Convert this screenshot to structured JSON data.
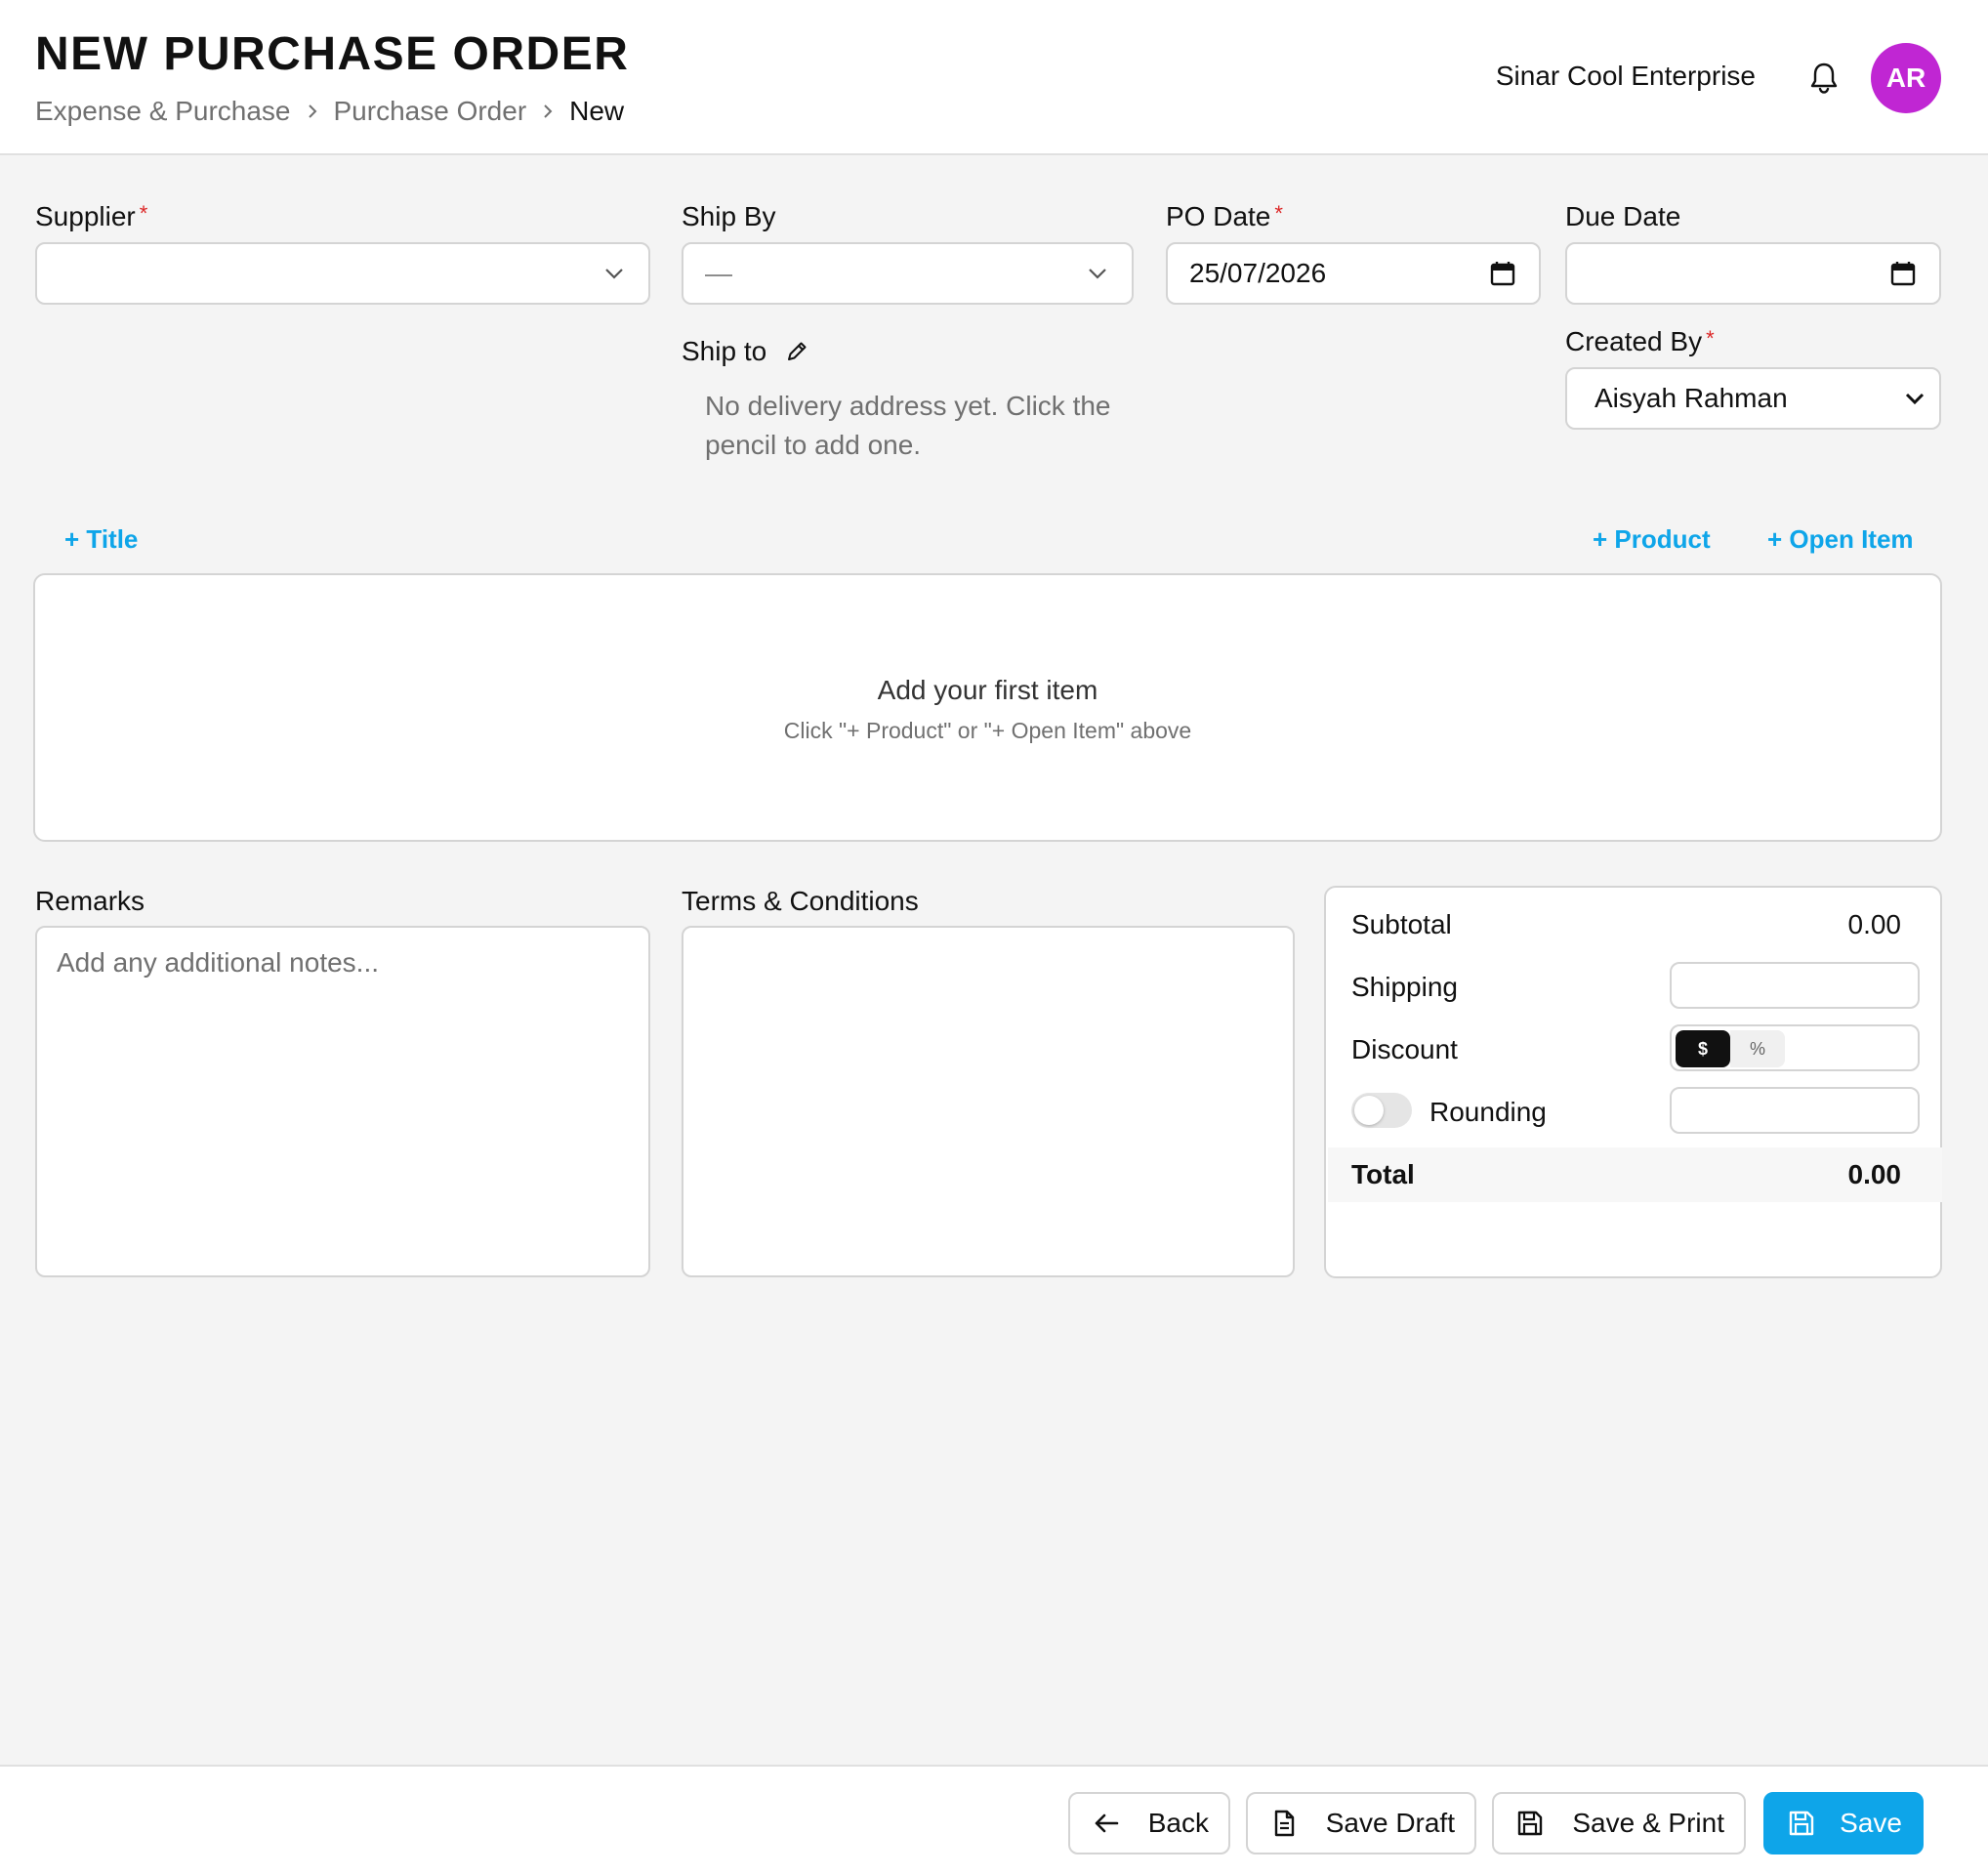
{
  "header": {
    "title": "NEW PURCHASE ORDER",
    "breadcrumb": [
      "Expense & Purchase",
      "Purchase Order",
      "New"
    ],
    "company": "Sinar Cool Enterprise",
    "avatar_initials": "AR",
    "avatar_color": "#c026d3"
  },
  "form": {
    "supplier": {
      "label": "Supplier",
      "required": "*",
      "value": ""
    },
    "ship_by": {
      "label": "Ship By",
      "value": "—"
    },
    "po_date": {
      "label": "PO Date",
      "required": "*",
      "value": "25/07/2026"
    },
    "due_date": {
      "label": "Due Date",
      "value": ""
    },
    "created_by": {
      "label": "Created By",
      "required": "*",
      "value": "Aisyah Rahman"
    },
    "ship_to": {
      "label": "Ship to",
      "hint": "No delivery address yet. Click the pencil to add one."
    }
  },
  "items": {
    "add_title": "+ Title",
    "add_product": "+ Product",
    "add_open_item": "+ Open Item",
    "empty_title": "Add your first item",
    "empty_hint": "Click \"+ Product\" or \"+ Open Item\" above"
  },
  "remarks": {
    "label": "Remarks",
    "placeholder": "Add any additional notes..."
  },
  "terms": {
    "label": "Terms & Conditions"
  },
  "summary": {
    "subtotal_label": "Subtotal",
    "subtotal_value": "0.00",
    "shipping_label": "Shipping",
    "discount_label": "Discount",
    "discount_dollar": "$",
    "discount_percent": "%",
    "rounding_label": "Rounding",
    "total_label": "Total",
    "total_value": "0.00"
  },
  "footer": {
    "back": "Back",
    "save_draft": "Save Draft",
    "save_print": "Save & Print",
    "save": "Save"
  },
  "colors": {
    "accent": "#0ea5e9",
    "required": "#dc2626"
  }
}
